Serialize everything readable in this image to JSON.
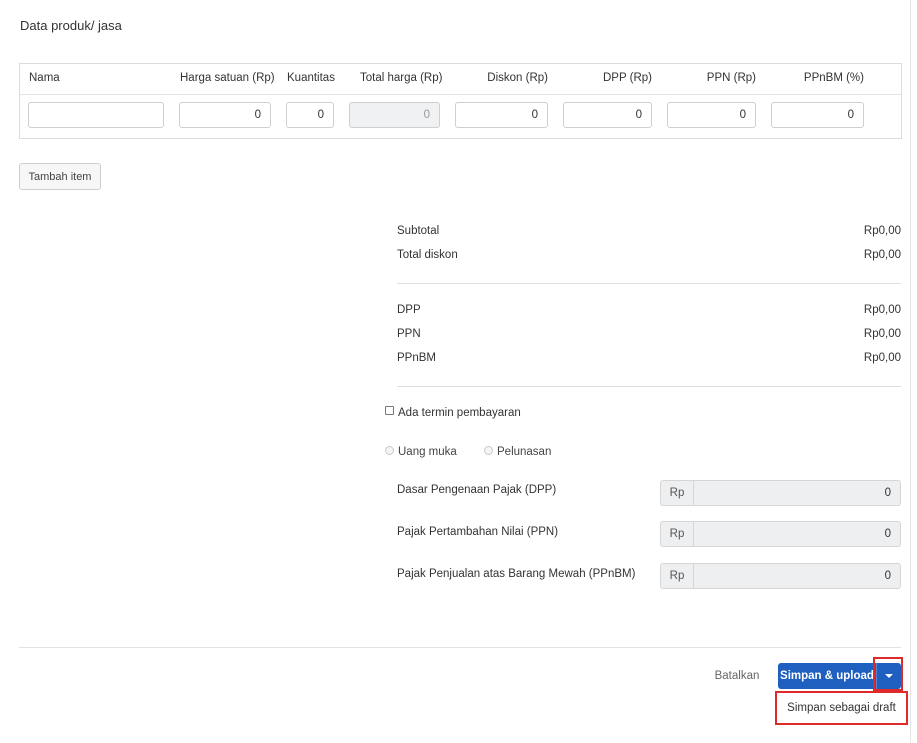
{
  "section": {
    "title": "Data produk/ jasa"
  },
  "table": {
    "headers": [
      "Nama",
      "Harga satuan (Rp)",
      "Kuantitas",
      "Total harga (Rp)",
      "Diskon (Rp)",
      "DPP (Rp)",
      "PPN (Rp)",
      "PPnBM (%)"
    ],
    "row": {
      "nama": "",
      "harga_satuan": "0",
      "kuantitas": "0",
      "total_harga": "0",
      "diskon": "0",
      "dpp": "0",
      "ppn": "0",
      "ppnbm": "0"
    }
  },
  "add_item_label": "Tambah item",
  "summary": {
    "subtotal_label": "Subtotal",
    "subtotal_value": "Rp0,00",
    "total_diskon_label": "Total diskon",
    "total_diskon_value": "Rp0,00",
    "dpp_label": "DPP",
    "dpp_value": "Rp0,00",
    "ppn_label": "PPN",
    "ppn_value": "Rp0,00",
    "ppnbm_label": "PPnBM",
    "ppnbm_value": "Rp0,00"
  },
  "termin": {
    "checkbox_label": "Ada termin pembayaran",
    "checked": false,
    "radio_uang_muka": "Uang muka",
    "radio_pelunasan": "Pelunasan"
  },
  "tax_fields": [
    {
      "label": "Dasar Pengenaan Pajak (DPP)",
      "prefix": "Rp",
      "value": "0"
    },
    {
      "label": "Pajak Pertambahan Nilai (PPN)",
      "prefix": "Rp",
      "value": "0"
    },
    {
      "label": "Pajak Penjualan atas Barang Mewah (PPnBM)",
      "prefix": "Rp",
      "value": "0"
    }
  ],
  "footer": {
    "cancel_label": "Batalkan",
    "primary_label": "Simpan & upload",
    "dropdown_item": "Simpan sebagai draft"
  },
  "colors": {
    "primary": "#1f5fbf",
    "highlight": "#e02a2a"
  },
  "icons": {
    "caret": "caret-down-icon"
  }
}
